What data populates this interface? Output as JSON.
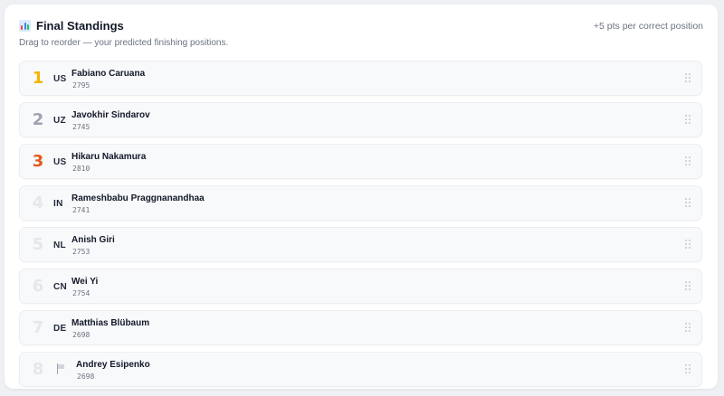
{
  "header": {
    "title": "Final Standings",
    "icon": "bar-chart-icon",
    "points_note": "+5 pts per correct position",
    "subtitle": "Drag to reorder — your predicted finishing positions."
  },
  "colors": {
    "gold": "#f4b400",
    "silver": "#9ca3af",
    "bronze": "#e05a1a",
    "muted": "#e5e7eb"
  },
  "standings": [
    {
      "rank": "1",
      "country": "US",
      "name": "Fabiano Caruana",
      "rating": "2795"
    },
    {
      "rank": "2",
      "country": "UZ",
      "name": "Javokhir Sindarov",
      "rating": "2745"
    },
    {
      "rank": "3",
      "country": "US",
      "name": "Hikaru Nakamura",
      "rating": "2810"
    },
    {
      "rank": "4",
      "country": "IN",
      "name": "Rameshbabu Praggnanandhaa",
      "rating": "2741"
    },
    {
      "rank": "5",
      "country": "NL",
      "name": "Anish Giri",
      "rating": "2753"
    },
    {
      "rank": "6",
      "country": "CN",
      "name": "Wei Yi",
      "rating": "2754"
    },
    {
      "rank": "7",
      "country": "DE",
      "name": "Matthias Blübaum",
      "rating": "2698"
    },
    {
      "rank": "8",
      "country": "",
      "country_icon": "white-flag-icon",
      "name": "Andrey Esipenko",
      "rating": "2698"
    }
  ]
}
